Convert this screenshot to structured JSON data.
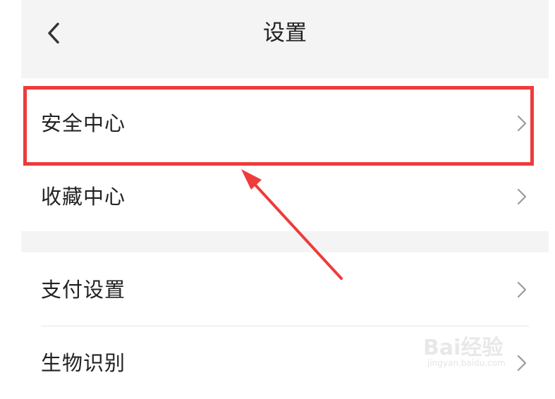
{
  "header": {
    "title": "设置",
    "back_icon": "chevron-left-icon"
  },
  "settings": {
    "items": [
      {
        "label": "安全中心",
        "icon": "chevron-right-icon",
        "highlighted": true
      },
      {
        "label": "收藏中心",
        "icon": "chevron-right-icon",
        "highlighted": false
      },
      {
        "label": "支付设置",
        "icon": "chevron-right-icon",
        "highlighted": false
      },
      {
        "label": "生物识别",
        "icon": "chevron-right-icon",
        "highlighted": false
      }
    ]
  },
  "annotation": {
    "color": "#ee3b3b"
  },
  "watermark": {
    "brand": "Bai经验",
    "url": "jingyan.baidu.com"
  },
  "colors": {
    "background": "#f4f4f4",
    "text": "#222222",
    "chevron": "#9a9a9a"
  }
}
